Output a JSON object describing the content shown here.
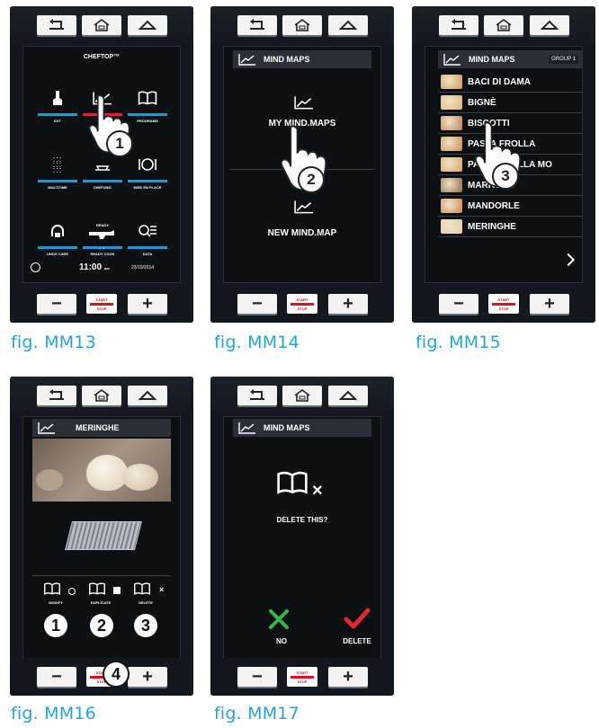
{
  "controls": {
    "minus": "−",
    "plus": "+",
    "start_line1": "START",
    "start_line2": "STOP"
  },
  "mm13": {
    "caption": "fig. MM13",
    "brand": "CHEFTOP™",
    "tiles": [
      {
        "label": "EXT",
        "stripe": "#2b95c9"
      },
      {
        "label": "M",
        "stripe": "#d6263b"
      },
      {
        "label": "PROGRAMS",
        "stripe": "#2b95c9"
      },
      {
        "label": "MULTITIME",
        "stripe": "#2b95c9"
      },
      {
        "label": "CHEFUNIC",
        "stripe": "#2b95c9"
      },
      {
        "label": "MISE EN PLACE",
        "stripe": "#2b95c9"
      },
      {
        "label": "UNOX CARE",
        "stripe": "#2b95c9"
      },
      {
        "label": "READY COOK",
        "stripe": "#2b95c9"
      },
      {
        "label": "DATA",
        "stripe": "#2b95c9"
      }
    ],
    "ready_text": "READY",
    "time": "11:00",
    "time_suffix": "am",
    "date": "23/10/2014",
    "step": "1"
  },
  "mm14": {
    "caption": "fig. MM14",
    "header": "MIND MAPS",
    "option1": "MY MIND.MAPS",
    "option2": "NEW MIND.MAP",
    "step": "2"
  },
  "mm15": {
    "caption": "fig. MM15",
    "header": "MIND MAPS",
    "group": "GROUP 1",
    "items": [
      "BACI DI DAMA",
      "BIGNÈ",
      "BISCOTTI",
      "PASTA FROLLA",
      "PASTA FROLLA MO",
      "MARRONS",
      "MANDORLE",
      "MERINGHE"
    ],
    "thumb_colors": [
      "#c99a5a",
      "#d9b67c",
      "#b9835a",
      "#c58f4e",
      "#d3a468",
      "#8d6a4c",
      "#c98a4e",
      "#e2cdb0"
    ],
    "next_icon": "chevron-right-icon",
    "step": "3"
  },
  "mm16": {
    "caption": "fig. MM16",
    "header": "MERINGHE",
    "actions": [
      {
        "label": "MODIFY",
        "icon": "book-view-icon"
      },
      {
        "label": "DUPLICATE",
        "icon": "book-copy-icon"
      },
      {
        "label": "DELETE",
        "icon": "book-delete-icon"
      }
    ],
    "badges": [
      "1",
      "2",
      "3"
    ],
    "badge4": "4"
  },
  "mm17": {
    "caption": "fig. MM17",
    "header": "MIND MAPS",
    "question": "DELETE THIS?",
    "no_label": "NO",
    "delete_label": "DELETE",
    "no_color": "#37b54a",
    "yes_color": "#e2292f"
  }
}
